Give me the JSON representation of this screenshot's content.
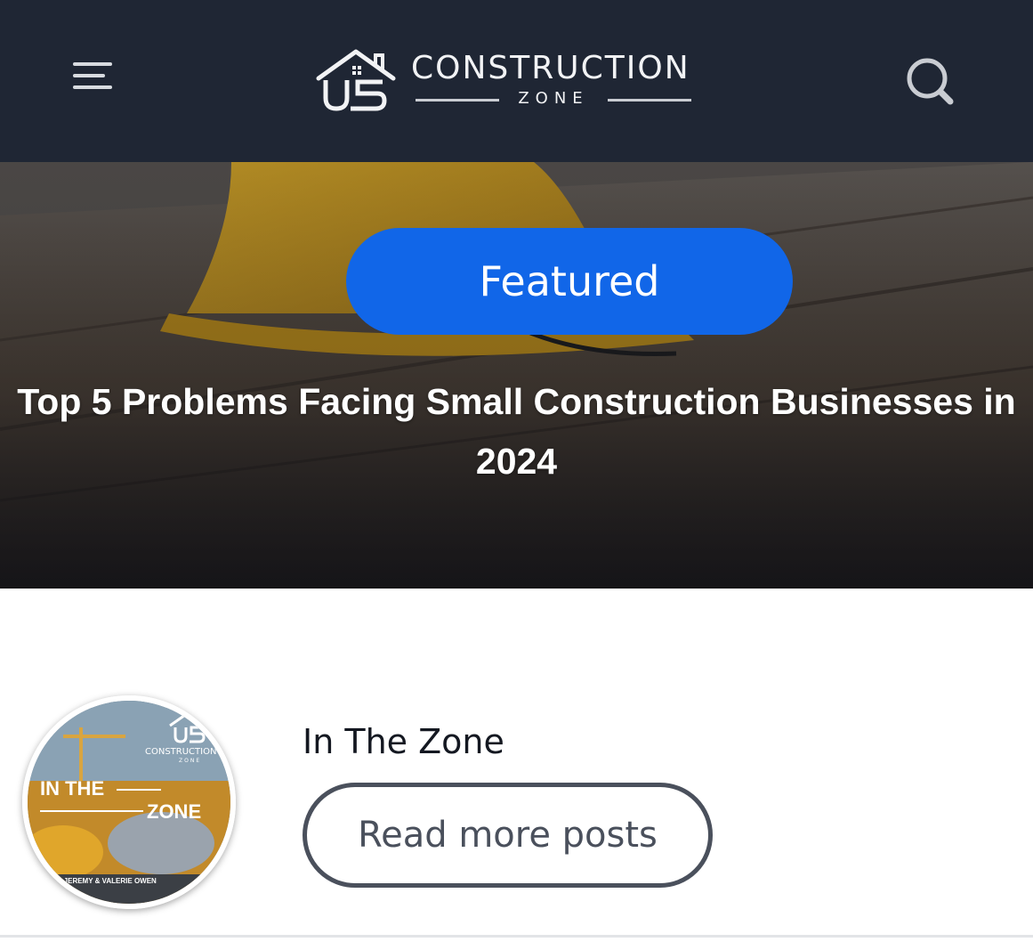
{
  "header": {
    "logo_mark": "US",
    "logo_title": "CONSTRUCTION",
    "logo_subtitle": "ZONE",
    "menu_icon": "hamburger-menu-icon",
    "search_icon": "search-icon",
    "background_color": "#1f2634"
  },
  "featured": {
    "badge_label": "Featured",
    "badge_color": "#1166e8",
    "title": "Top 5 Problems Facing Small Construction Businesses in 2024",
    "image_subject": "yellow hard hat on wooden beam"
  },
  "blog": {
    "avatar_text_in_the": "IN THE",
    "avatar_text_zone": "ZONE",
    "avatar_text_hosts": "WITH JEREMY & VALERIE OWEN",
    "avatar_logo_text": "CONSTRUCTION",
    "avatar_logo_sub": "ZONE",
    "name": "In The Zone",
    "read_more_label": "Read more posts"
  }
}
